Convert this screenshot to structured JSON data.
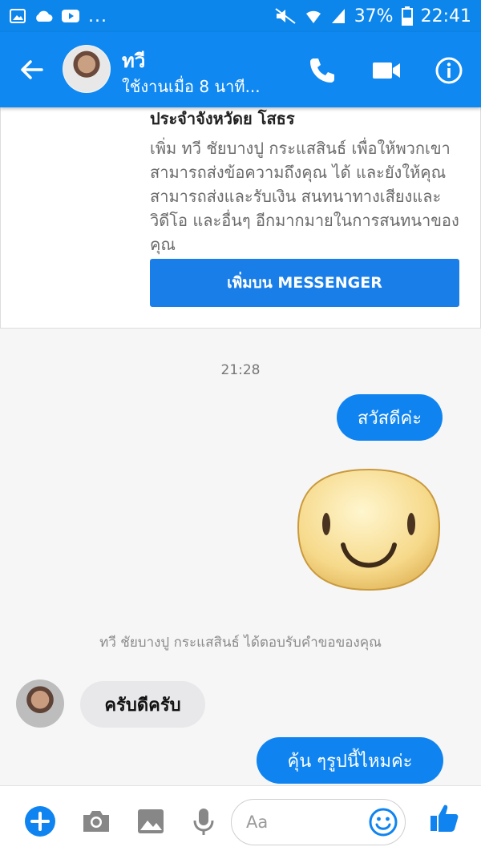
{
  "status_bar": {
    "battery": "37%",
    "time": "22:41",
    "overflow": "..."
  },
  "header": {
    "name": "ทวี",
    "status": "ใช้งานเมื่อ 8 นาที..."
  },
  "card": {
    "title": "ประจำจังหวัดย โสธร",
    "body": "เพิ่ม ทวี ชัยบางปู กระแสสินธ์ เพื่อให้พวกเขาสามารถส่งข้อความถึงคุณ ได้ และยังให้คุณสามารถส่งและรับเงิน สนทนาทางเสียงและวิดีโอ และอื่นๆ อีกมากมายในการสนทนาของคุณ",
    "button": "เพิ่มบน MESSENGER"
  },
  "chat": {
    "timestamp": "21:28",
    "msg1": "สวัสดีค่ะ",
    "notice": "ทวี ชัยบางปู กระแสสินธ์ ได้ตอบรับคำขอของคุณ",
    "msg2": "ครับดีครับ",
    "msg3": "คุ้น ๆรูปนี้ไหมค่ะ"
  },
  "composer": {
    "placeholder": "Aa"
  },
  "colors": {
    "accent": "#0f84f0",
    "bar": "#0f88f2",
    "incoming": "#e8e8ea"
  },
  "icons": [
    "back-arrow-icon",
    "phone-icon",
    "video-icon",
    "info-icon",
    "plus-icon",
    "camera-icon",
    "image-icon",
    "mic-icon",
    "emoji-icon",
    "thumbs-up-icon",
    "smiley-sticker"
  ]
}
